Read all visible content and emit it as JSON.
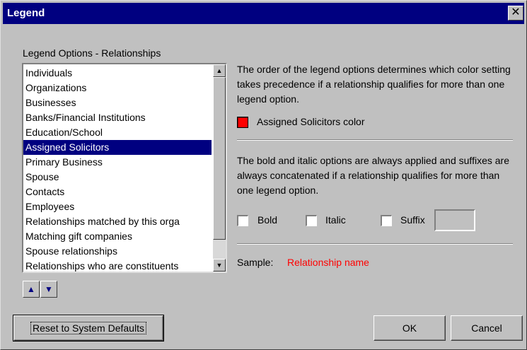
{
  "window": {
    "title": "Legend",
    "close_glyph": "✕"
  },
  "group": {
    "label": "Legend Options - Relationships"
  },
  "list": {
    "items": [
      "Individuals",
      "Organizations",
      "Businesses",
      "Banks/Financial Institutions",
      "Education/School",
      "Assigned Solicitors",
      "Primary Business",
      "Spouse",
      "Contacts",
      "Employees",
      "Relationships matched by this orga",
      "Matching gift companies",
      "Spouse relationships",
      "Relationships who are constituents"
    ],
    "selected_index": 5
  },
  "order_note": "The order of the legend options determines which color setting takes precedence if a relationship qualifies for more than one legend option.",
  "color": {
    "label": "Assigned Solicitors color",
    "value": "#ff0000"
  },
  "style_note": "The bold and italic options are always applied and suffixes are always concatenated if a relationship qualifies for more than one legend option.",
  "options": {
    "bold_label": "Bold",
    "italic_label": "Italic",
    "suffix_label": "Suffix",
    "suffix_value": ""
  },
  "sample": {
    "label": "Sample:",
    "value": "Relationship name",
    "color": "#ff0000"
  },
  "buttons": {
    "reset_label": "Reset to System Defaults",
    "ok_label": "OK",
    "cancel_label": "Cancel"
  },
  "icons": {
    "move_up": "arrow-up-icon",
    "move_down": "arrow-down-icon",
    "scroll_up": "scroll-up-icon",
    "scroll_down": "scroll-down-icon"
  }
}
